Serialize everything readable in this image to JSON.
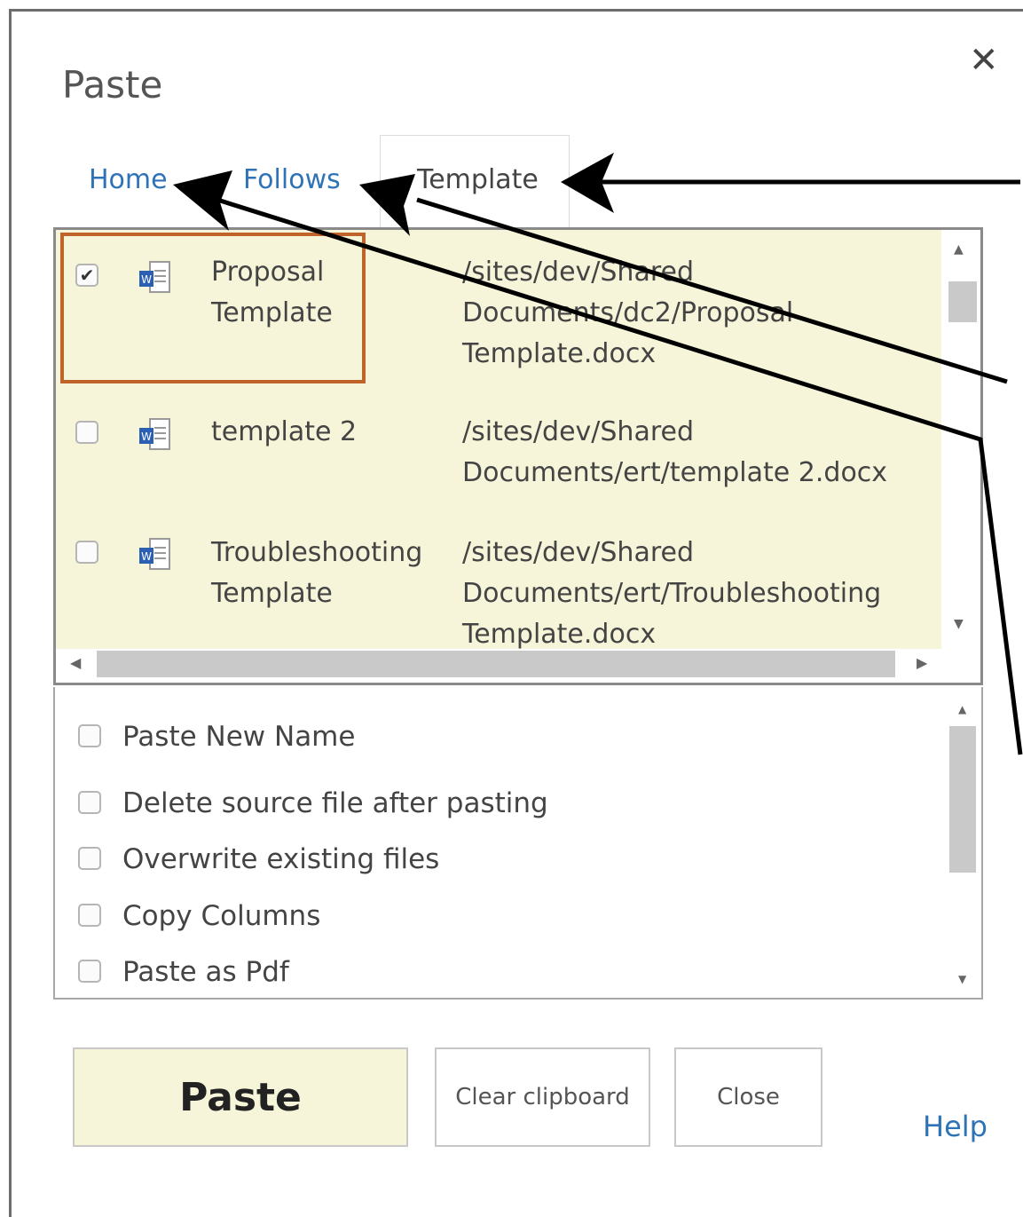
{
  "dialog": {
    "title": "Paste",
    "close_glyph": "✕"
  },
  "tabs": [
    {
      "label": "Home",
      "active": false
    },
    {
      "label": "Follows",
      "active": false
    },
    {
      "label": "Template",
      "active": true
    }
  ],
  "files": [
    {
      "name_line1": "Proposal",
      "name_line2": "Template",
      "path_line1": "/sites/dev/Shared",
      "path_line2": "Documents/dc2/Proposal",
      "path_line3": "Template.docx",
      "checked": true,
      "icon": "word-document-icon"
    },
    {
      "name_line1": "template 2",
      "name_line2": "",
      "path_line1": "/sites/dev/Shared",
      "path_line2": "Documents/ert/template 2.docx",
      "path_line3": "",
      "checked": false,
      "icon": "word-document-icon"
    },
    {
      "name_line1": "Troubleshooting",
      "name_line2": "Template",
      "path_line1": "/sites/dev/Shared",
      "path_line2": "Documents/ert/Troubleshooting",
      "path_line3": "Template.docx",
      "checked": false,
      "icon": "word-document-icon"
    }
  ],
  "options": [
    {
      "label": "Paste New Name",
      "checked": false
    },
    {
      "label": "Delete source file after pasting",
      "checked": false
    },
    {
      "label": "Overwrite existing files",
      "checked": false
    },
    {
      "label": "Copy Columns",
      "checked": false
    },
    {
      "label": "Paste as Pdf",
      "checked": false
    }
  ],
  "buttons": {
    "paste": "Paste",
    "clear": "Clear clipboard",
    "close": "Close",
    "help": "Help"
  },
  "colors": {
    "row_highlight": "#f7f5d9",
    "link_blue": "#2f73b7",
    "selection_border": "#c0632a",
    "annotation_arrow": "#000000"
  }
}
